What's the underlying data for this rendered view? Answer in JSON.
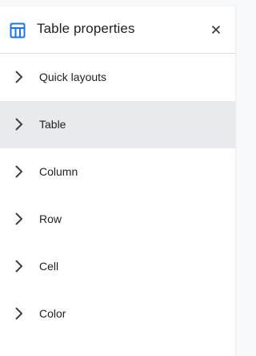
{
  "panel": {
    "title": "Table properties",
    "icon": "table-icon",
    "close_icon": "close-icon",
    "accent_color": "#1a73e8"
  },
  "sections": [
    {
      "label": "Quick layouts",
      "active": false
    },
    {
      "label": "Table",
      "active": true
    },
    {
      "label": "Column",
      "active": false
    },
    {
      "label": "Row",
      "active": false
    },
    {
      "label": "Cell",
      "active": false
    },
    {
      "label": "Color",
      "active": false
    }
  ]
}
